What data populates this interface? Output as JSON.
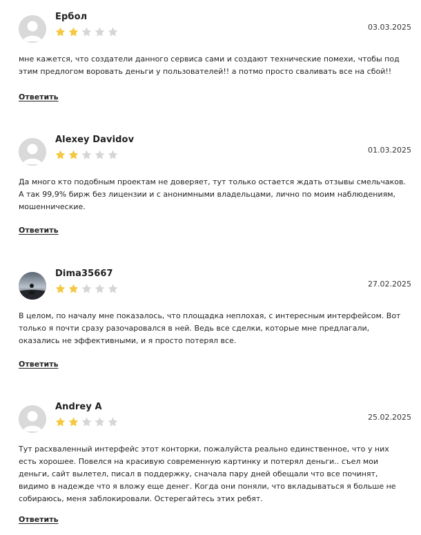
{
  "reviews": [
    {
      "author": "Ербол",
      "date": "03.03.2025",
      "rating": 2,
      "avatar": "default-avatar",
      "text": "мне кажется, что создатели данного сервиса сами и создают технические помехи, чтобы под этим предлогом воровать деньги у пользователей!! а потмо просто сваливать все на сбой!!",
      "reply_label": "Ответить"
    },
    {
      "author": "Alexey Davidov",
      "date": "01.03.2025",
      "rating": 2,
      "avatar": "default-avatar",
      "text": "Да много кто подобным проектам не доверяет, тут только остается ждать отзывы смельчаков. А так 99,9% бирж без лицензии и с анонимными владельцами, лично по моим наблюдениям, мошеннические.",
      "reply_label": "Ответить"
    },
    {
      "author": "Dima35667",
      "date": "27.02.2025",
      "rating": 2,
      "avatar": "photo-avatar",
      "text": "В целом, по началу мне показалось, что площадка неплохая, с интересным интерфейсом. Вот только я почти сразу разочаровался в ней. Ведь все сделки, которые мне предлагали, оказались не эффективными, и я просто потерял все.",
      "reply_label": "Ответить"
    },
    {
      "author": "Andrey A",
      "date": "25.02.2025",
      "rating": 2,
      "avatar": "default-avatar",
      "text": "Тут расхваленный интерфейс этот конторки, пожалуйста реально единственное, что у них есть хорошее. Повелся на красивую современную картинку и потерял деньги.. съел мои деньги, сайт вылетел, писал в поддержку, сначала пару дней обещали что все починят, видимо в надежде что я вложу еще денег. Когда они поняли, что вкладываться я больше не собираюсь, меня заблокировали. Остерегайтесь этих ребят.",
      "reply_label": "Ответить"
    }
  ],
  "colors": {
    "star_filled": "#f5c842",
    "star_empty": "#d6d6d6",
    "avatar_bg": "#d9d9d9"
  },
  "max_rating": 5
}
